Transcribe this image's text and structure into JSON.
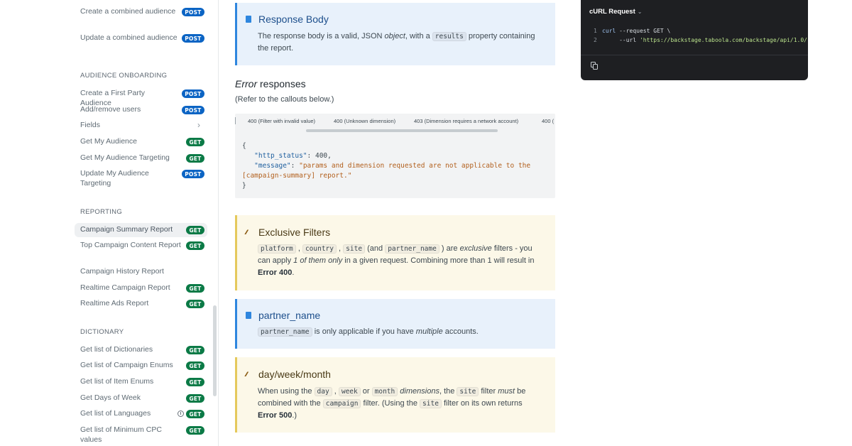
{
  "sidebar": {
    "top_items": [
      {
        "label": "Create a combined audience",
        "method": "POST"
      },
      {
        "label": "Update a combined audience",
        "method": "POST"
      }
    ],
    "sections": [
      {
        "heading": "AUDIENCE ONBOARDING",
        "items": [
          {
            "label": "Create a First Party Audience",
            "method": "POST"
          },
          {
            "label": "Add/remove users",
            "method": "POST"
          },
          {
            "label": "Fields",
            "method": ""
          },
          {
            "label": "Get My Audience",
            "method": "GET"
          },
          {
            "label": "Get My Audience Targeting",
            "method": "GET"
          },
          {
            "label": "Update My Audience Targeting",
            "method": "POST"
          }
        ]
      },
      {
        "heading": "REPORTING",
        "items": [
          {
            "label": "Campaign Summary Report",
            "method": "GET",
            "active": true
          },
          {
            "label": "Top Campaign Content Report",
            "method": "GET"
          },
          {
            "label": "Campaign History Report",
            "method": ""
          },
          {
            "label": "Realtime Campaign Report",
            "method": "GET"
          },
          {
            "label": "Realtime Ads Report",
            "method": "GET"
          }
        ]
      },
      {
        "heading": "DICTIONARY",
        "items": [
          {
            "label": "Get list of Dictionaries",
            "method": "GET"
          },
          {
            "label": "Get list of Campaign Enums",
            "method": "GET"
          },
          {
            "label": "Get list of Item Enums",
            "method": "GET"
          },
          {
            "label": "Get Days of Week",
            "method": "GET"
          },
          {
            "label": "Get list of Languages",
            "method": "GET"
          },
          {
            "label": "Get list of Minimum CPC values",
            "method": "GET"
          }
        ]
      }
    ]
  },
  "response_body": {
    "title": "Response Body",
    "text_before": "The response body is a valid, JSON ",
    "text_em": "object",
    "text_mid": ", with a ",
    "code": "results",
    "text_after": " property containing the report."
  },
  "errors": {
    "heading_em": "Error",
    "heading_rest": " responses",
    "subtext": "(Refer to the callouts below.)",
    "tabs": [
      "400 (Filter with invalid value)",
      "400 (Unknown dimension)",
      "403 (Dimension requires a network account)",
      "400 ("
    ],
    "json": {
      "open": "{",
      "key1": "\"http_status\"",
      "val1": "400",
      "key2": "\"message\"",
      "val2a": "\"params and dimension requested are not applicable to the",
      "val2b": "[campaign-summary] report.\"",
      "close": "}"
    }
  },
  "exclusive_filters": {
    "title": "Exclusive Filters",
    "code1": "platform",
    "code2": "country",
    "code3": "site",
    "and_open": " (and ",
    "code4": "partner_name",
    "are": " ) are ",
    "exclusive_em": "exclusive",
    "t1": " filters - you can apply ",
    "only_em": "1 of them only",
    "t2": " in a given request. Combining more than 1 will result in ",
    "bold": "Error 400",
    "end": "."
  },
  "partner_name": {
    "title": "partner_name",
    "code": "partner_name",
    "t1": " is only applicable if you have ",
    "em": "multiple",
    "t2": " accounts."
  },
  "day_week_month": {
    "title": "day/week/month",
    "t1": "When using the ",
    "code1": "day",
    "code2": "week",
    "or": " or ",
    "code3": "month",
    "em1": " dimensions",
    "t2": ", the ",
    "code4": "site",
    "t3": " filter ",
    "em2": "must",
    "t4": " be combined with the ",
    "code5": "campaign",
    "t5": " filter. (Using the ",
    "code6": "site",
    "t6": " filter on its own returns ",
    "bold": "Error 500",
    "end": ".)"
  },
  "curl": {
    "title": "cURL Request",
    "line1_num": "1",
    "line1_cmd": "curl",
    "line1_rest": " --request GET \\",
    "line2_num": "2",
    "line2_pre": "     --url ",
    "line2_url": "'https://backstage.taboola.com/backstage/api/1.0/"
  },
  "colors": {
    "post_badge": "#0b64c4",
    "get_badge": "#0b7a46",
    "info_border": "#2e86de",
    "warn_border": "#e5c95c",
    "curl_bg": "#1e1f22"
  }
}
